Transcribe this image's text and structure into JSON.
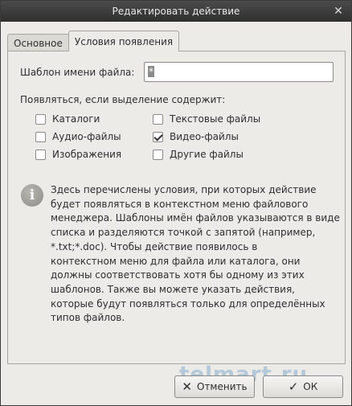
{
  "window": {
    "title": "Редактировать действие",
    "close_icon": "close-icon"
  },
  "tabs": [
    {
      "label": "Основное",
      "active": false
    },
    {
      "label": "Условия появления",
      "active": true
    }
  ],
  "filename_pattern": {
    "label": "Шаблон имени файла:",
    "value": "*"
  },
  "selection_section": {
    "label": "Появляться, если выделение содержит:",
    "options": [
      {
        "label": "Каталоги",
        "checked": false
      },
      {
        "label": "Текстовые файлы",
        "checked": false
      },
      {
        "label": "Аудио-файлы",
        "checked": false
      },
      {
        "label": "Видео-файлы",
        "checked": true
      },
      {
        "label": "Изображения",
        "checked": false
      },
      {
        "label": "Другие файлы",
        "checked": false
      }
    ]
  },
  "info": {
    "icon": "info-icon",
    "lines": [
      "Здесь перечислены условия, при которых действие",
      "будет появляться в контекстном меню файлового",
      "менеджера. Шаблоны имён файлов указываются в виде",
      "списка и разделяются точкой с запятой (например,",
      "*.txt;*.doc). Чтобы действие появилось в",
      "контекстном меню для файла или каталога, они",
      "должны соответствовать хотя бы одному из этих",
      "шаблонов.  Также вы можете указать действия,",
      "которые будут появляться только для определённых",
      "типов файлов."
    ]
  },
  "buttons": {
    "cancel_label": "Отменить",
    "ok_label": "ОК"
  },
  "watermark": "telmart.ru"
}
